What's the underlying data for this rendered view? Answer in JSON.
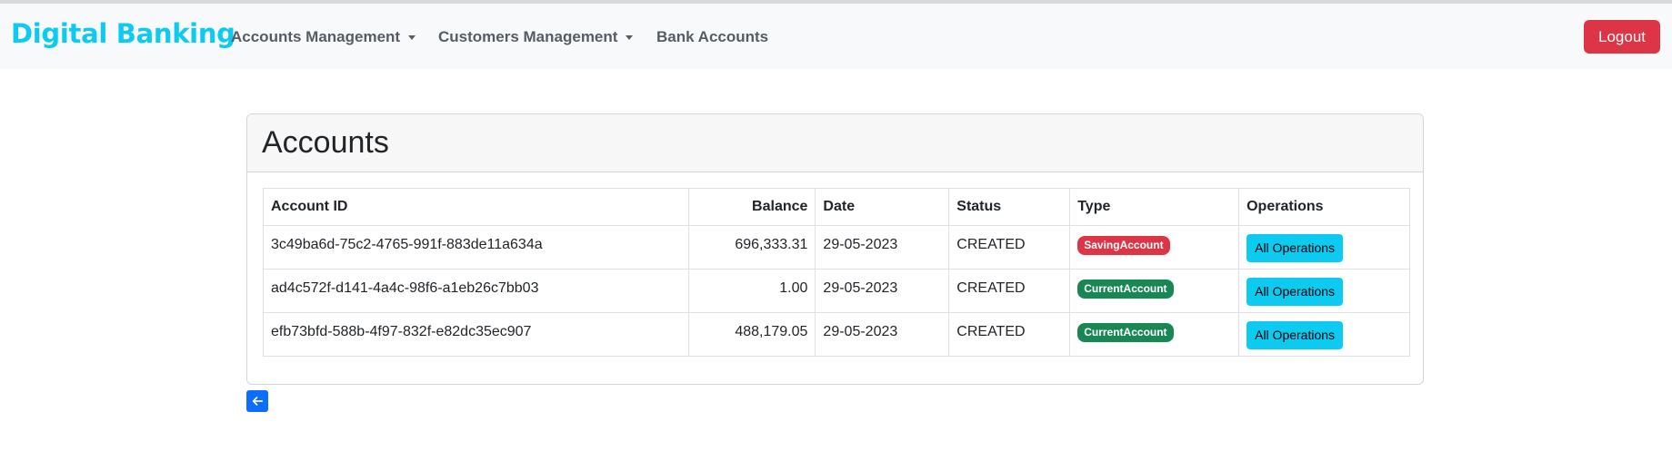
{
  "navbar": {
    "brand": "Digital Banking",
    "items": [
      {
        "label": "Accounts Management"
      },
      {
        "label": "Customers Management"
      },
      {
        "label": "Bank Accounts"
      }
    ],
    "logout_label": "Logout"
  },
  "colors": {
    "brand": "#0dcaf0",
    "danger": "#dc3545",
    "success": "#198754",
    "info": "#0dcaf0",
    "primary": "#0d6efd"
  },
  "card": {
    "title": "Accounts"
  },
  "table": {
    "headers": [
      "Account ID",
      "Balance",
      "Date",
      "Status",
      "Type",
      "Operations"
    ],
    "rows": [
      {
        "id": "3c49ba6d-75c2-4765-991f-883de11a634a",
        "balance": "696,333.31",
        "date": "29-05-2023",
        "status": "CREATED",
        "type": "SavingAccount",
        "operations_label": "All Operations"
      },
      {
        "id": "ad4c572f-d141-4a4c-98f6-a1eb26c7bb03",
        "balance": "1.00",
        "date": "29-05-2023",
        "status": "CREATED",
        "type": "CurrentAccount",
        "operations_label": "All Operations"
      },
      {
        "id": "efb73bfd-588b-4f97-832f-e82dc35ec907",
        "balance": "488,179.05",
        "date": "29-05-2023",
        "status": "CREATED",
        "type": "CurrentAccount",
        "operations_label": "All Operations"
      }
    ]
  },
  "back_button": {
    "icon": "arrow-left-icon"
  }
}
